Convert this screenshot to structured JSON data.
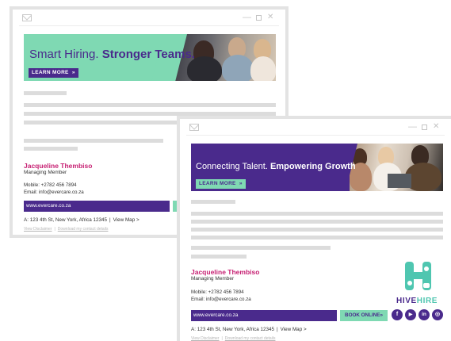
{
  "window1": {
    "banner": {
      "headline_light": "Smart Hiring.",
      "headline_bold": "Stronger Teams.",
      "button_label": "LEARN MORE"
    },
    "signature": {
      "name": "Jacqueline Thembiso",
      "role": "Managing Member",
      "mobile": "Mobile: +2782 456 7894",
      "email": "Email: info@evercare.co.za",
      "website": "www.evercare.co.za",
      "address": "A: 123 4th St, New York, Africa 12345",
      "map_link": "View Map >",
      "disclaimer_link": "View Disclaimer",
      "download_link": "Download my contact details"
    }
  },
  "window2": {
    "banner": {
      "headline_light": "Connecting Talent.",
      "headline_bold": "Empowering Growth",
      "button_label": "LEARN MORE"
    },
    "signature": {
      "name": "Jacqueline Thembiso",
      "role": "Managing Member",
      "mobile": "Mobile: +2782 456 7894",
      "email": "Email: info@evercare.co.za",
      "website": "www.evercare.co.za",
      "book_button": "BOOK ONLINE",
      "address": "A: 123 4th St, New York, Africa 12345",
      "map_link": "View Map >",
      "disclaimer_link": "View Disclaimer",
      "download_link": "Download my contact details"
    },
    "logo": {
      "part1": "HIVE",
      "part2": "HIRE"
    },
    "social": [
      {
        "icon": "facebook-icon",
        "glyph": "f"
      },
      {
        "icon": "youtube-icon",
        "glyph": "▶"
      },
      {
        "icon": "linkedin-icon",
        "glyph": "in"
      },
      {
        "icon": "instagram-icon",
        "glyph": "◎"
      }
    ]
  },
  "colors": {
    "purple": "#4a2a8c",
    "mint": "#7fd9b3",
    "magenta": "#c61f72",
    "teal": "#4fc6b0"
  }
}
